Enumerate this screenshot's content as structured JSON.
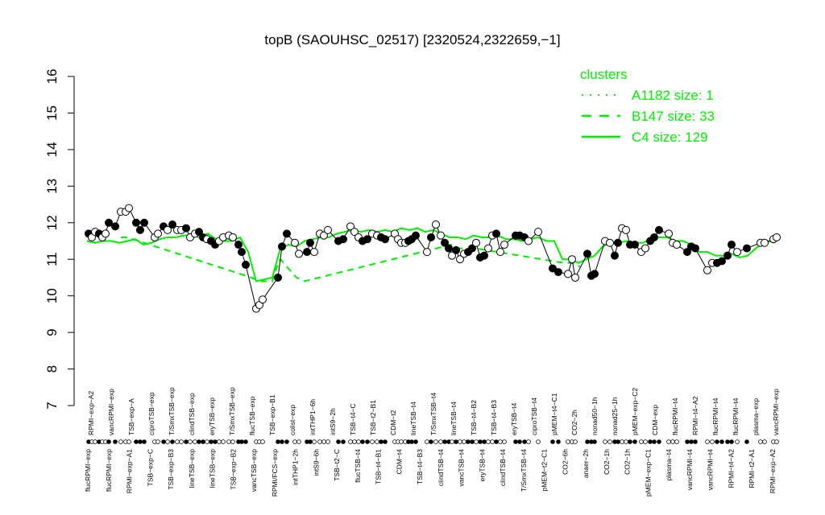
{
  "chart_data": {
    "type": "line",
    "title": "topB (SAOUHSC_02517) [2320524,2322659,−1]",
    "xlabel": "",
    "ylabel": "",
    "ylim": [
      7,
      16
    ],
    "yticks": [
      7,
      8,
      9,
      10,
      11,
      12,
      13,
      14,
      15,
      16
    ],
    "grid": false,
    "legend": {
      "title": "clusters",
      "placement": "top-right",
      "color": "#00ee00",
      "entries": [
        {
          "label": "A1182 size: 1",
          "style": "dotted"
        },
        {
          "label": "B147 size: 33",
          "style": "dashed"
        },
        {
          "label": "C4 size: 129",
          "style": "solid"
        }
      ]
    },
    "x_labels_top": [
      "RPMI−exp−A2",
      "vancRPMI−exp",
      "TSB−exp−A",
      "ciproTSB−exp",
      "T/SmxTSB−exp",
      "clindTSB−exp",
      "eryTSB−exp",
      "T/SmxTSB−exp",
      "flucTSB−exp",
      "TSB−exp−B1",
      "colist−exp",
      "intTHP1−6h",
      "intS9−2h",
      "TSB−t4−C",
      "TSB−t2−B1",
      "CDM−t2",
      "lineTSB−t4",
      "T/SmxTSB−t4",
      "lineTSB−t4",
      "TSB−t4−B2",
      "TSB−t4−B3",
      "eryTSB−t4",
      "ciproTSB−t4",
      "pMEM−t4−C1",
      "CO2−2h",
      "nonad50−1h",
      "nonad25−1h",
      "pMEM−exp−C2",
      "CDM−exp",
      "flucRPMI−t4",
      "RPMI−t4−A2",
      "flucRPMI−t4",
      "flucRPMI−t4",
      "plasma−exp",
      "vancRPMI−exp"
    ],
    "x_labels_bottom": [
      "flucRPMI−exp",
      "flucRPMI−exp",
      "RPMI−exp−A1",
      "TSB−exp−C",
      "TSB−exp−B3",
      "lineTSB−exp",
      "lineTSB−exp",
      "TSB−exp−B2",
      "vancTSB−exp",
      "RPMI/FCS−exp",
      "intTHP1−2h",
      "intS9−6h",
      "TSB−t2−C",
      "flucTSB−t4",
      "TSB−t4−B1",
      "CDM−t4",
      "TSB−t4−B3",
      "clindTSB−t4",
      "vancTSB−t4",
      "eryTSB−t4",
      "clindTSB−t4",
      "T/SmxTSB−t4",
      "pMEM−t2−C1",
      "CO2−6h",
      "anaer−2h",
      "CO2−1h",
      "CO2−1h",
      "pMEM−exp−C1",
      "plasma−t4",
      "vancRPMI−t4",
      "vancRPMI−t4",
      "RPMI−t4−A2",
      "RPMI−t2−A1",
      "RPMI−exp−A2"
    ],
    "series": [
      {
        "style": "solid",
        "x": [
          108,
          118,
          128,
          138,
          148,
          158,
          168,
          178,
          188,
          198,
          208,
          218,
          228,
          238,
          248,
          258,
          268,
          278,
          288,
          298,
          308,
          318,
          328,
          338,
          348,
          358,
          368,
          378,
          388,
          398,
          408,
          418,
          428,
          438,
          448,
          458,
          468,
          478,
          488,
          498,
          508,
          518,
          528,
          538,
          548,
          558,
          568,
          578,
          588,
          598,
          608,
          618,
          628,
          638,
          648,
          658,
          668,
          678,
          688,
          698,
          708,
          718,
          728,
          738,
          748,
          758,
          768,
          778,
          788,
          798,
          808,
          818,
          828,
          838,
          848,
          858,
          868,
          878,
          888,
          898,
          908,
          918,
          928,
          938,
          948,
          958,
          966
        ],
        "values": [
          11.5,
          11.45,
          11.5,
          11.5,
          11.45,
          11.5,
          11.55,
          11.4,
          11.45,
          11.55,
          11.6,
          11.6,
          11.65,
          11.65,
          11.6,
          11.7,
          11.55,
          11.5,
          11.5,
          11.6,
          11.2,
          10.4,
          10.45,
          10.5,
          11.3,
          11.4,
          11.35,
          11.5,
          11.55,
          11.6,
          11.6,
          11.7,
          11.75,
          11.8,
          11.75,
          11.8,
          11.75,
          11.8,
          11.75,
          11.85,
          11.8,
          11.85,
          11.75,
          11.8,
          11.7,
          11.6,
          11.6,
          11.55,
          11.65,
          11.6,
          11.6,
          11.65,
          11.55,
          11.55,
          11.5,
          11.55,
          11.6,
          11.5,
          11.5,
          11.0,
          11.0,
          10.9,
          11.0,
          11.1,
          11.35,
          11.45,
          11.45,
          11.5,
          11.45,
          11.45,
          11.55,
          11.6,
          11.6,
          11.5,
          11.5,
          11.4,
          11.2,
          11.2,
          11.1,
          11.1,
          11.15,
          11.05,
          11.1,
          11.3,
          11.45,
          11.5,
          11.55
        ]
      },
      {
        "style": "dashed",
        "x": [
          150,
          158,
          312,
          322,
          330,
          338,
          342,
          348,
          368,
          378,
          560,
          570,
          580,
          590,
          700,
          710,
          720
        ],
        "values": [
          11.6,
          11.6,
          10.5,
          10.4,
          10.4,
          10.4,
          10.7,
          11.0,
          10.5,
          10.4,
          11.4,
          11.3,
          11.3,
          11.3,
          10.9,
          10.9,
          10.8
        ]
      }
    ],
    "points": [
      {
        "x": 110,
        "y": 11.7,
        "fill": "black"
      },
      {
        "x": 114,
        "y": 11.6,
        "fill": "white"
      },
      {
        "x": 118,
        "y": 11.75,
        "fill": "white"
      },
      {
        "x": 123,
        "y": 11.7,
        "fill": "black"
      },
      {
        "x": 127,
        "y": 11.6,
        "fill": "white"
      },
      {
        "x": 131,
        "y": 11.7,
        "fill": "white"
      },
      {
        "x": 135,
        "y": 12.0,
        "fill": "black"
      },
      {
        "x": 143,
        "y": 11.9,
        "fill": "black"
      },
      {
        "x": 150,
        "y": 12.3,
        "fill": "white"
      },
      {
        "x": 156,
        "y": 12.3,
        "fill": "white"
      },
      {
        "x": 160,
        "y": 12.4,
        "fill": "white"
      },
      {
        "x": 169,
        "y": 12.0,
        "fill": "black"
      },
      {
        "x": 174,
        "y": 11.8,
        "fill": "black"
      },
      {
        "x": 179,
        "y": 12.0,
        "fill": "black"
      },
      {
        "x": 192,
        "y": 11.6,
        "fill": "white"
      },
      {
        "x": 196,
        "y": 11.7,
        "fill": "white"
      },
      {
        "x": 203,
        "y": 11.9,
        "fill": "black"
      },
      {
        "x": 208,
        "y": 11.8,
        "fill": "white"
      },
      {
        "x": 214,
        "y": 11.95,
        "fill": "black"
      },
      {
        "x": 220,
        "y": 11.8,
        "fill": "white"
      },
      {
        "x": 225,
        "y": 11.8,
        "fill": "white"
      },
      {
        "x": 231,
        "y": 11.85,
        "fill": "black"
      },
      {
        "x": 236,
        "y": 11.6,
        "fill": "white"
      },
      {
        "x": 242,
        "y": 11.7,
        "fill": "white"
      },
      {
        "x": 247,
        "y": 11.75,
        "fill": "black"
      },
      {
        "x": 252,
        "y": 11.6,
        "fill": "black"
      },
      {
        "x": 257,
        "y": 11.55,
        "fill": "white"
      },
      {
        "x": 262,
        "y": 11.5,
        "fill": "black"
      },
      {
        "x": 267,
        "y": 11.4,
        "fill": "black"
      },
      {
        "x": 272,
        "y": 11.5,
        "fill": "white"
      },
      {
        "x": 277,
        "y": 11.6,
        "fill": "white"
      },
      {
        "x": 284,
        "y": 11.65,
        "fill": "white"
      },
      {
        "x": 289,
        "y": 11.6,
        "fill": "white"
      },
      {
        "x": 296,
        "y": 11.4,
        "fill": "black"
      },
      {
        "x": 300,
        "y": 11.2,
        "fill": "black"
      },
      {
        "x": 305,
        "y": 10.85,
        "fill": "black"
      },
      {
        "x": 318,
        "y": 9.65,
        "fill": "white"
      },
      {
        "x": 322,
        "y": 9.75,
        "fill": "white"
      },
      {
        "x": 326,
        "y": 9.9,
        "fill": "white"
      },
      {
        "x": 345,
        "y": 10.5,
        "fill": "black"
      },
      {
        "x": 350,
        "y": 11.35,
        "fill": "black"
      },
      {
        "x": 356,
        "y": 11.7,
        "fill": "black"
      },
      {
        "x": 366,
        "y": 11.45,
        "fill": "white"
      },
      {
        "x": 371,
        "y": 11.15,
        "fill": "white"
      },
      {
        "x": 381,
        "y": 11.2,
        "fill": "black"
      },
      {
        "x": 385,
        "y": 11.45,
        "fill": "black"
      },
      {
        "x": 390,
        "y": 11.2,
        "fill": "white"
      },
      {
        "x": 397,
        "y": 11.7,
        "fill": "white"
      },
      {
        "x": 402,
        "y": 11.65,
        "fill": "white"
      },
      {
        "x": 407,
        "y": 11.8,
        "fill": "white"
      },
      {
        "x": 420,
        "y": 11.5,
        "fill": "black"
      },
      {
        "x": 426,
        "y": 11.55,
        "fill": "black"
      },
      {
        "x": 435,
        "y": 11.9,
        "fill": "white"
      },
      {
        "x": 440,
        "y": 11.75,
        "fill": "white"
      },
      {
        "x": 445,
        "y": 11.6,
        "fill": "white"
      },
      {
        "x": 450,
        "y": 11.5,
        "fill": "black"
      },
      {
        "x": 456,
        "y": 11.55,
        "fill": "black"
      },
      {
        "x": 462,
        "y": 11.7,
        "fill": "white"
      },
      {
        "x": 468,
        "y": 11.65,
        "fill": "white"
      },
      {
        "x": 473,
        "y": 11.6,
        "fill": "black"
      },
      {
        "x": 478,
        "y": 11.55,
        "fill": "black"
      },
      {
        "x": 490,
        "y": 11.7,
        "fill": "white"
      },
      {
        "x": 494,
        "y": 11.55,
        "fill": "white"
      },
      {
        "x": 498,
        "y": 11.45,
        "fill": "white"
      },
      {
        "x": 503,
        "y": 11.45,
        "fill": "white"
      },
      {
        "x": 507,
        "y": 11.5,
        "fill": "black"
      },
      {
        "x": 511,
        "y": 11.55,
        "fill": "black"
      },
      {
        "x": 516,
        "y": 11.65,
        "fill": "black"
      },
      {
        "x": 530,
        "y": 11.2,
        "fill": "white"
      },
      {
        "x": 535,
        "y": 11.6,
        "fill": "black"
      },
      {
        "x": 541,
        "y": 11.95,
        "fill": "white"
      },
      {
        "x": 547,
        "y": 11.65,
        "fill": "white"
      },
      {
        "x": 552,
        "y": 11.45,
        "fill": "black"
      },
      {
        "x": 557,
        "y": 11.3,
        "fill": "black"
      },
      {
        "x": 561,
        "y": 11.1,
        "fill": "white"
      },
      {
        "x": 566,
        "y": 11.25,
        "fill": "black"
      },
      {
        "x": 571,
        "y": 11.0,
        "fill": "white"
      },
      {
        "x": 576,
        "y": 11.15,
        "fill": "white"
      },
      {
        "x": 581,
        "y": 11.2,
        "fill": "black"
      },
      {
        "x": 586,
        "y": 11.3,
        "fill": "black"
      },
      {
        "x": 591,
        "y": 11.45,
        "fill": "white"
      },
      {
        "x": 596,
        "y": 11.05,
        "fill": "black"
      },
      {
        "x": 601,
        "y": 11.1,
        "fill": "black"
      },
      {
        "x": 606,
        "y": 11.3,
        "fill": "white"
      },
      {
        "x": 611,
        "y": 11.65,
        "fill": "white"
      },
      {
        "x": 616,
        "y": 11.7,
        "fill": "black"
      },
      {
        "x": 621,
        "y": 11.2,
        "fill": "white"
      },
      {
        "x": 626,
        "y": 11.4,
        "fill": "white"
      },
      {
        "x": 640,
        "y": 11.65,
        "fill": "black"
      },
      {
        "x": 645,
        "y": 11.65,
        "fill": "black"
      },
      {
        "x": 651,
        "y": 11.6,
        "fill": "black"
      },
      {
        "x": 656,
        "y": 11.5,
        "fill": "white"
      },
      {
        "x": 668,
        "y": 11.75,
        "fill": "white"
      },
      {
        "x": 686,
        "y": 10.75,
        "fill": "black"
      },
      {
        "x": 693,
        "y": 10.65,
        "fill": "black"
      },
      {
        "x": 705,
        "y": 10.6,
        "fill": "white"
      },
      {
        "x": 710,
        "y": 11.0,
        "fill": "white"
      },
      {
        "x": 714,
        "y": 10.5,
        "fill": "white"
      },
      {
        "x": 729,
        "y": 11.15,
        "fill": "black"
      },
      {
        "x": 734,
        "y": 10.55,
        "fill": "black"
      },
      {
        "x": 738,
        "y": 10.6,
        "fill": "black"
      },
      {
        "x": 751,
        "y": 11.5,
        "fill": "white"
      },
      {
        "x": 757,
        "y": 11.45,
        "fill": "white"
      },
      {
        "x": 763,
        "y": 11.1,
        "fill": "black"
      },
      {
        "x": 767,
        "y": 11.45,
        "fill": "black"
      },
      {
        "x": 772,
        "y": 11.85,
        "fill": "white"
      },
      {
        "x": 777,
        "y": 11.8,
        "fill": "white"
      },
      {
        "x": 782,
        "y": 11.4,
        "fill": "black"
      },
      {
        "x": 788,
        "y": 11.4,
        "fill": "black"
      },
      {
        "x": 796,
        "y": 11.2,
        "fill": "white"
      },
      {
        "x": 801,
        "y": 11.3,
        "fill": "white"
      },
      {
        "x": 807,
        "y": 11.5,
        "fill": "black"
      },
      {
        "x": 812,
        "y": 11.6,
        "fill": "black"
      },
      {
        "x": 818,
        "y": 11.8,
        "fill": "black"
      },
      {
        "x": 830,
        "y": 11.7,
        "fill": "white"
      },
      {
        "x": 835,
        "y": 11.45,
        "fill": "white"
      },
      {
        "x": 840,
        "y": 11.4,
        "fill": "white"
      },
      {
        "x": 853,
        "y": 11.2,
        "fill": "black"
      },
      {
        "x": 858,
        "y": 11.35,
        "fill": "black"
      },
      {
        "x": 863,
        "y": 11.3,
        "fill": "black"
      },
      {
        "x": 878,
        "y": 10.7,
        "fill": "white"
      },
      {
        "x": 884,
        "y": 10.9,
        "fill": "white"
      },
      {
        "x": 890,
        "y": 10.9,
        "fill": "black"
      },
      {
        "x": 896,
        "y": 10.95,
        "fill": "black"
      },
      {
        "x": 903,
        "y": 11.1,
        "fill": "black"
      },
      {
        "x": 908,
        "y": 11.4,
        "fill": "black"
      },
      {
        "x": 915,
        "y": 11.2,
        "fill": "white"
      },
      {
        "x": 927,
        "y": 11.3,
        "fill": "black"
      },
      {
        "x": 944,
        "y": 11.45,
        "fill": "white"
      },
      {
        "x": 949,
        "y": 11.45,
        "fill": "white"
      },
      {
        "x": 960,
        "y": 11.55,
        "fill": "white"
      },
      {
        "x": 964,
        "y": 11.6,
        "fill": "white"
      }
    ]
  }
}
